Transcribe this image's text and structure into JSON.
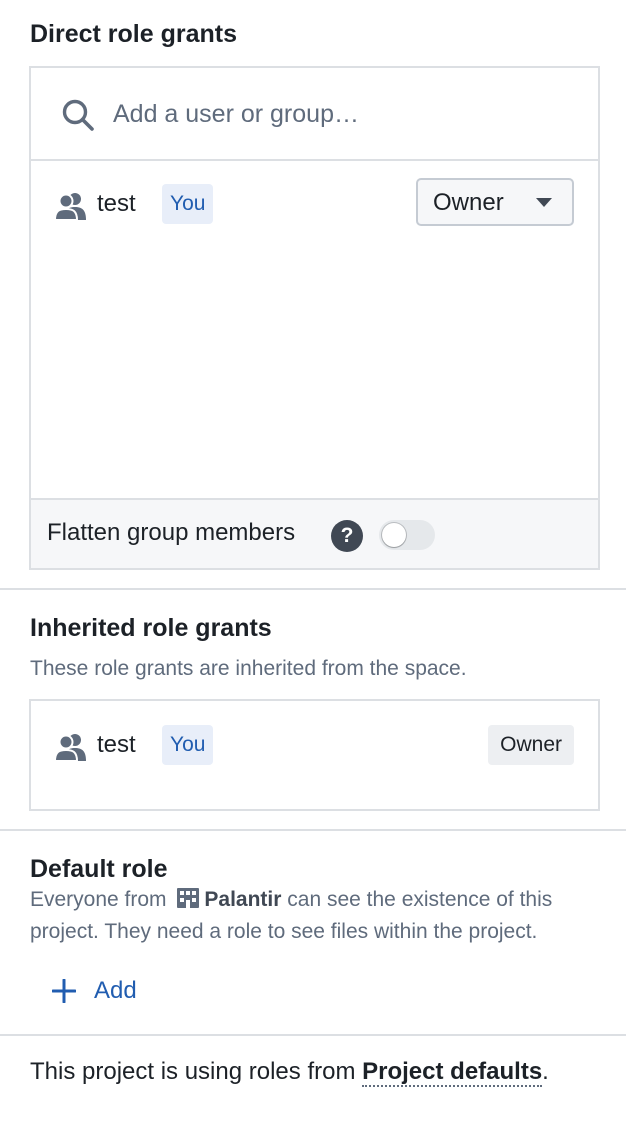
{
  "direct": {
    "heading": "Direct role grants",
    "search_placeholder": "Add a user or group…",
    "grant": {
      "name": "test",
      "tag": "You",
      "role": "Owner"
    },
    "flatten_label": "Flatten group members",
    "help_icon_text": "?",
    "flatten_enabled": false
  },
  "inherited": {
    "heading": "Inherited role grants",
    "description": "These role grants are inherited from the space.",
    "grant": {
      "name": "test",
      "tag": "You",
      "role": "Owner"
    }
  },
  "default_role": {
    "heading": "Default role",
    "desc_prefix": "Everyone from",
    "org_name": "Palantir",
    "desc_suffix": "can see the existence of this project. They need a role to see files within the project.",
    "add_label": "Add"
  },
  "footer": {
    "prefix": "This project is using roles from",
    "link": "Project defaults",
    "suffix": "."
  },
  "colors": {
    "accent": "#215db0",
    "tag_bg": "#e8eef9",
    "border": "#dcdfe3",
    "text": "#1c2127",
    "muted": "#5f6b7c"
  }
}
